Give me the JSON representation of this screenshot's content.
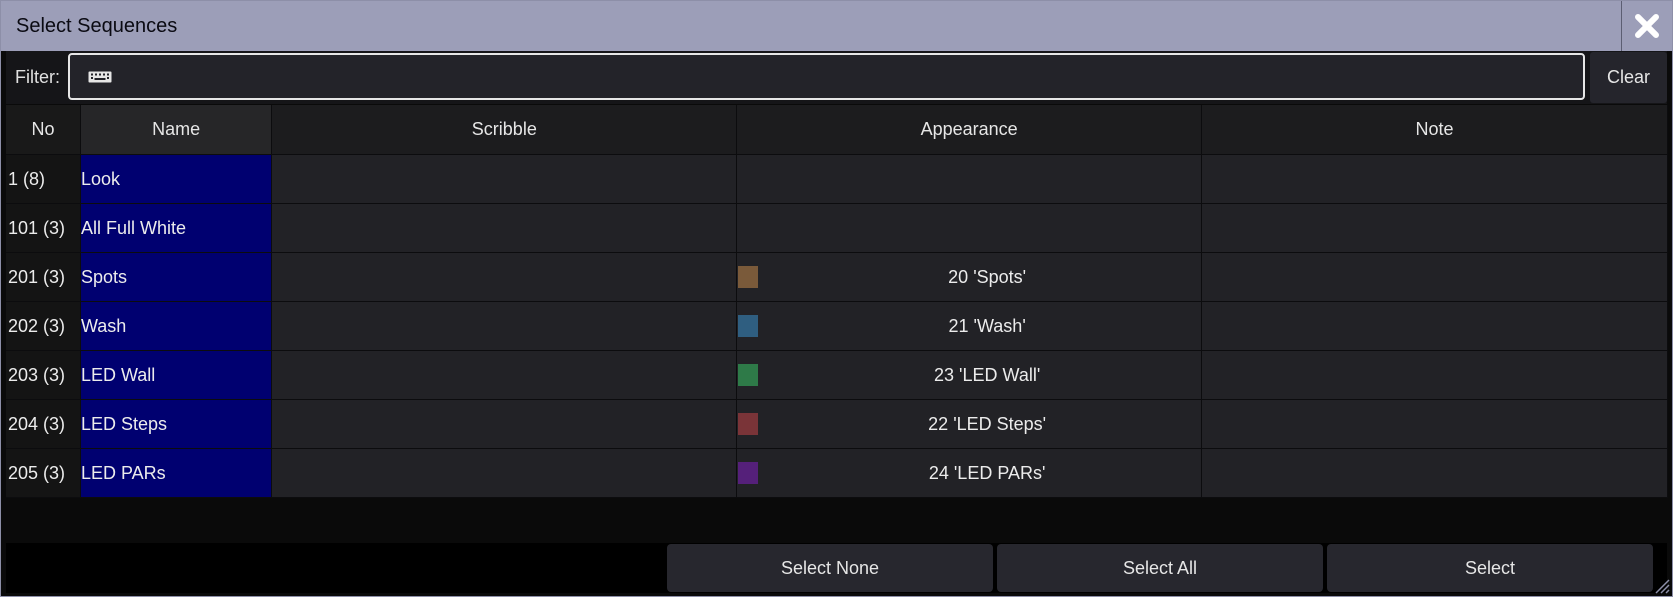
{
  "window": {
    "title": "Select Sequences"
  },
  "icons": {
    "close": "close-icon",
    "keyboard": "keyboard-icon",
    "resize": "resize-grip-icon"
  },
  "filter": {
    "label": "Filter:",
    "value": "",
    "clear_label": "Clear"
  },
  "table": {
    "headers": {
      "no": "No",
      "name": "Name",
      "scribble": "Scribble",
      "appearance": "Appearance",
      "note": "Note"
    },
    "rows": [
      {
        "no": "1 (8)",
        "name": "Look",
        "scribble": "",
        "appearance": "",
        "color": "",
        "note": ""
      },
      {
        "no": "101 (3)",
        "name": "All Full White",
        "scribble": "",
        "appearance": "",
        "color": "",
        "note": ""
      },
      {
        "no": "201 (3)",
        "name": "Spots",
        "scribble": "",
        "appearance": "20 'Spots'",
        "color": "#7a5a3a",
        "note": ""
      },
      {
        "no": "202 (3)",
        "name": "Wash",
        "scribble": "",
        "appearance": "21 'Wash'",
        "color": "#2f5e80",
        "note": ""
      },
      {
        "no": "203 (3)",
        "name": "LED Wall",
        "scribble": "",
        "appearance": "23 'LED Wall'",
        "color": "#2e7a48",
        "note": ""
      },
      {
        "no": "204 (3)",
        "name": "LED Steps",
        "scribble": "",
        "appearance": "22 'LED Steps'",
        "color": "#7a3438",
        "note": ""
      },
      {
        "no": "205 (3)",
        "name": "LED PARs",
        "scribble": "",
        "appearance": "24 'LED PARs'",
        "color": "#55207a",
        "note": ""
      }
    ]
  },
  "footer": {
    "select_none": "Select None",
    "select_all": "Select All",
    "select": "Select"
  },
  "colors": {
    "titlebar": "#9c9eb8",
    "name_cell": "#000070",
    "cell": "#222226"
  }
}
